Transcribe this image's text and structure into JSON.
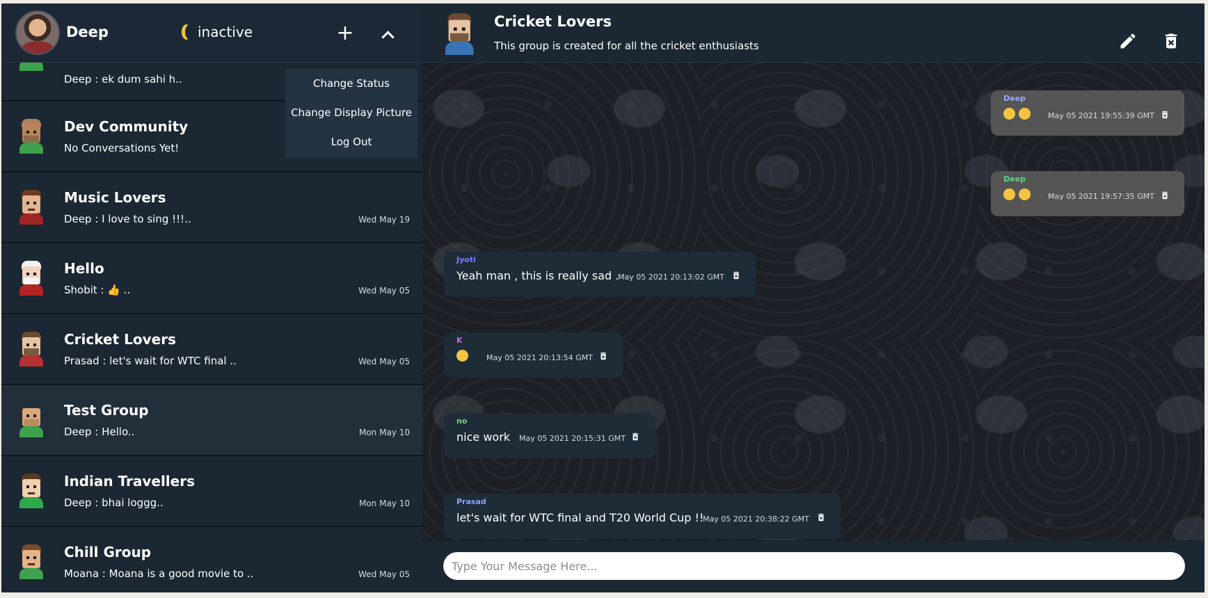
{
  "user": {
    "name": "Deep",
    "status": "inactive"
  },
  "header_buttons": {
    "add": "+"
  },
  "dropdown": {
    "items": [
      "Change Status",
      "Change Display Picture",
      "Log Out"
    ]
  },
  "chats": [
    {
      "title": "",
      "last": "Deep : ek dum sahi h..",
      "date": ""
    },
    {
      "title": "Dev Community",
      "last": "No Conversations Yet!",
      "date": ""
    },
    {
      "title": "Music Lovers",
      "last": "Deep : I love to sing !!!..",
      "date": "Wed May 19"
    },
    {
      "title": "Hello",
      "last": "Shobit : 👍 ..",
      "date": "Wed May 05"
    },
    {
      "title": "Cricket Lovers",
      "last": "Prasad : let's wait for WTC final ..",
      "date": "Wed May 05"
    },
    {
      "title": "Test Group",
      "last": "Deep : Hello..",
      "date": "Mon May 10"
    },
    {
      "title": "Indian Travellers",
      "last": "Deep : bhai loggg..",
      "date": "Mon May 10"
    },
    {
      "title": "Chill Group",
      "last": "Moana : Moana is a good movie to ..",
      "date": "Wed May 05"
    }
  ],
  "group": {
    "title": "Cricket Lovers",
    "description": "This group is created for all the cricket enthusiasts"
  },
  "messages": [
    {
      "sender": "Deep",
      "sender_color": "#9aa8ff",
      "text": "😞😞",
      "time": "May 05 2021 19:55:39 GMT",
      "own": true
    },
    {
      "sender": "Deep",
      "sender_color": "#5fd38a",
      "text": "😸😸",
      "time": "May 05 2021 19:57:35 GMT",
      "own": true
    },
    {
      "sender": "Jyoti",
      "sender_color": "#7b7cff",
      "text": "Yeah man , this is really sad .",
      "time": "May 05 2021 20:13:02 GMT",
      "own": false
    },
    {
      "sender": "K",
      "sender_color": "#d06bd8",
      "text": "😢",
      "time": "May 05 2021 20:13:54 GMT",
      "own": false
    },
    {
      "sender": "no",
      "sender_color": "#7ed48a",
      "text": "nice work",
      "time": "May 05 2021 20:15:31 GMT",
      "own": false
    },
    {
      "sender": "Prasad",
      "sender_color": "#8aa2ff",
      "text": "let's wait for WTC final and T20 World Cup !!",
      "time": "May 05 2021 20:38:22 GMT",
      "own": false
    }
  ],
  "composer": {
    "placeholder": "Type Your Message Here..."
  }
}
